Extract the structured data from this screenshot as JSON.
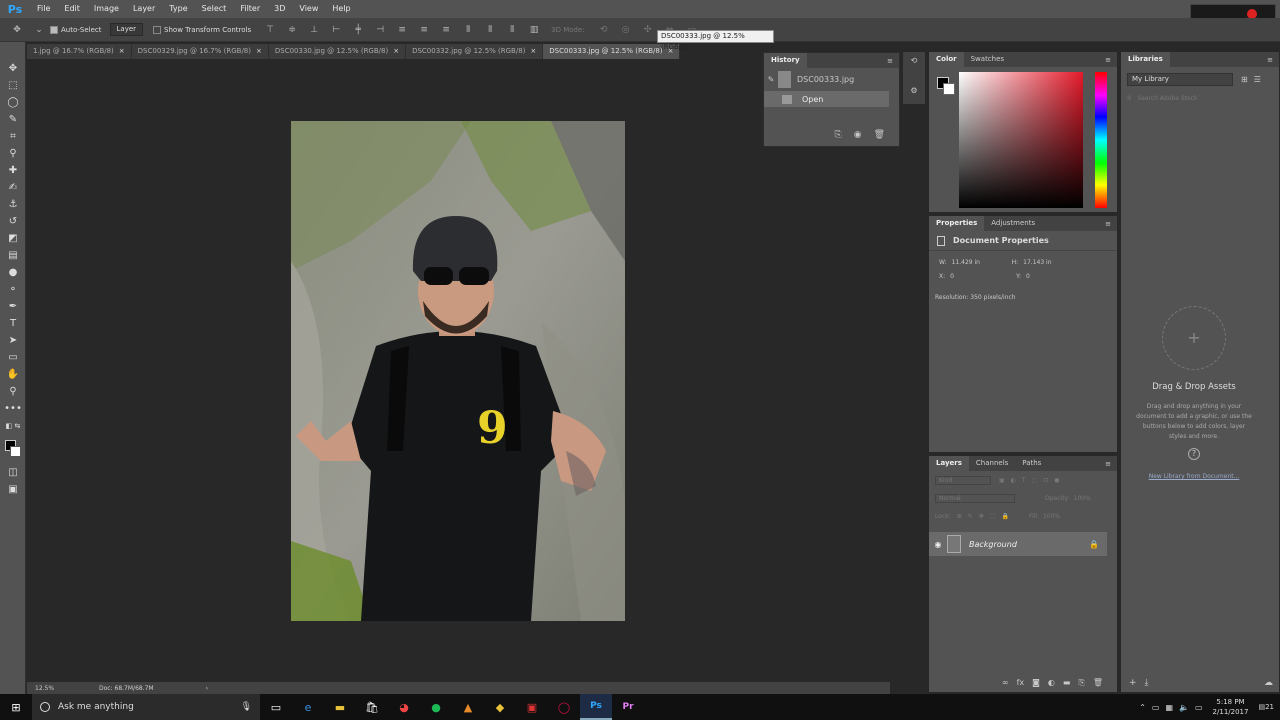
{
  "app": {
    "logo": "Ps"
  },
  "menu": [
    "File",
    "Edit",
    "Image",
    "Layer",
    "Type",
    "Select",
    "Filter",
    "3D",
    "View",
    "Help"
  ],
  "options": {
    "auto_select": "Auto-Select",
    "layer_select": "Layer",
    "show_transform": "Show Transform Controls",
    "mode_3d": "3D Mode:"
  },
  "tabs": [
    {
      "label": "1.jpg @ 16.7% (RGB/8)"
    },
    {
      "label": "DSC00329.jpg @ 16.7% (RGB/8)"
    },
    {
      "label": "DSC00330.jpg @ 12.5% (RGB/8)"
    },
    {
      "label": "DSC00332.jpg @ 12.5% (RGB/8)"
    },
    {
      "label": "DSC00333.jpg @ 12.5% (RGB/8)"
    }
  ],
  "tooltip": "DSC00333.jpg @ 12.5% (RGB/8)",
  "history": {
    "title": "History",
    "snapshot": "DSC00333.jpg",
    "step": "Open"
  },
  "color": {
    "tab1": "Color",
    "tab2": "Swatches"
  },
  "properties": {
    "tab1": "Properties",
    "tab2": "Adjustments",
    "section": "Document Properties",
    "w_label": "W:",
    "w": "11.429 in",
    "h_label": "H:",
    "h": "17.143 in",
    "x_label": "X:",
    "x": "0",
    "y_label": "Y:",
    "y": "0",
    "resolution": "Resolution: 350 pixels/inch"
  },
  "layers": {
    "tab1": "Layers",
    "tab2": "Channels",
    "tab3": "Paths",
    "kind": "Kind",
    "blend": "Normal",
    "opacity_label": "Opacity:",
    "opacity": "100%",
    "lock_label": "Lock:",
    "fill_label": "Fill:",
    "fill": "100%",
    "layer_name": "Background"
  },
  "libraries": {
    "title": "Libraries",
    "library": "My Library",
    "search_placeholder": "Search Adobe Stock",
    "heading": "Drag & Drop Assets",
    "body": "Drag and drop anything in your document to add a graphic, or use the buttons below to add colors, layer styles and more.",
    "link": "New Library from Document..."
  },
  "status": {
    "zoom": "12.5%",
    "doc": "Doc: 68.7M/68.7M"
  },
  "taskbar": {
    "search": "Ask me anything",
    "time": "5:18 PM",
    "date": "2/11/2017",
    "notif": "21"
  },
  "shirt_number": "9"
}
